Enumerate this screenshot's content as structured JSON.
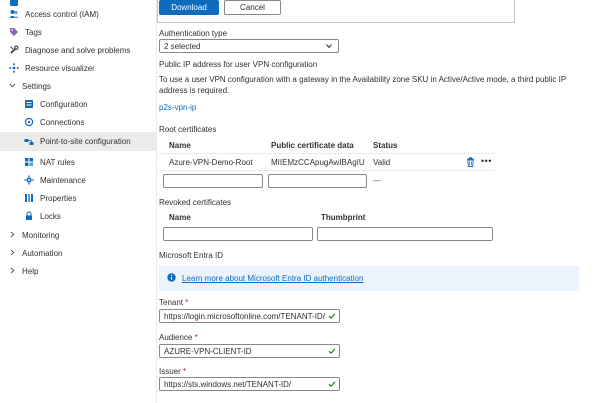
{
  "sidebar": {
    "items": [
      {
        "label": "Access control (IAM)",
        "icon": "people-icon"
      },
      {
        "label": "Tags",
        "icon": "tag-icon"
      },
      {
        "label": "Diagnose and solve problems",
        "icon": "wrench-icon"
      },
      {
        "label": "Resource visualizer",
        "icon": "visualizer-icon"
      },
      {
        "label": "Settings",
        "icon": "chevron-down-icon"
      },
      {
        "label": "Configuration",
        "icon": "configuration-icon"
      },
      {
        "label": "Connections",
        "icon": "connections-icon"
      },
      {
        "label": "Point-to-site configuration",
        "icon": "point-to-site-icon"
      },
      {
        "label": "NAT rules",
        "icon": "nat-rules-icon"
      },
      {
        "label": "Maintenance",
        "icon": "maintenance-icon"
      },
      {
        "label": "Properties",
        "icon": "properties-icon"
      },
      {
        "label": "Locks",
        "icon": "lock-icon"
      },
      {
        "label": "Monitoring",
        "icon": "chevron-right-icon"
      },
      {
        "label": "Automation",
        "icon": "chevron-right-icon"
      },
      {
        "label": "Help",
        "icon": "chevron-right-icon"
      }
    ]
  },
  "toolbar": {
    "download_label": "Download",
    "cancel_label": "Cancel"
  },
  "auth": {
    "label": "Authentication type",
    "value": "2 selected"
  },
  "public_ip": {
    "heading": "Public IP address for user VPN configuration",
    "description": "To use a user VPN configuration with a gateway in the Availability zone SKU in Active/Active mode, a third public IP address is required.",
    "link": "p2s-vpn-ip"
  },
  "root_certs": {
    "heading": "Root certificates",
    "columns": {
      "name": "Name",
      "data": "Public certificate data",
      "status": "Status"
    },
    "row": {
      "name": "Azure-VPN-Demo-Root",
      "data": "MIIEMzCCApugAwIBAgIUiW...",
      "status": "Valid"
    },
    "empty_status": "—"
  },
  "revoked_certs": {
    "heading": "Revoked certificates",
    "columns": {
      "name": "Name",
      "thumbprint": "Thumbprint"
    }
  },
  "entra": {
    "heading": "Microsoft Entra ID",
    "info_link": "Learn more about Microsoft Entra ID authentication",
    "tenant_label": "Tenant",
    "tenant_value": "https://login.microsoftonline.com/TENANT-ID/",
    "audience_label": "Audience",
    "audience_value": "AZURE-VPN-CLIENT-ID",
    "issuer_label": "Issuer",
    "issuer_value": "https://sts.windows.net/TENANT-ID/",
    "required_mark": "*"
  },
  "colors": {
    "accent": "#0f6cbd",
    "valid_check": "#107c10",
    "info_bg": "#ebf3fc",
    "active_bg": "#edebe9"
  }
}
